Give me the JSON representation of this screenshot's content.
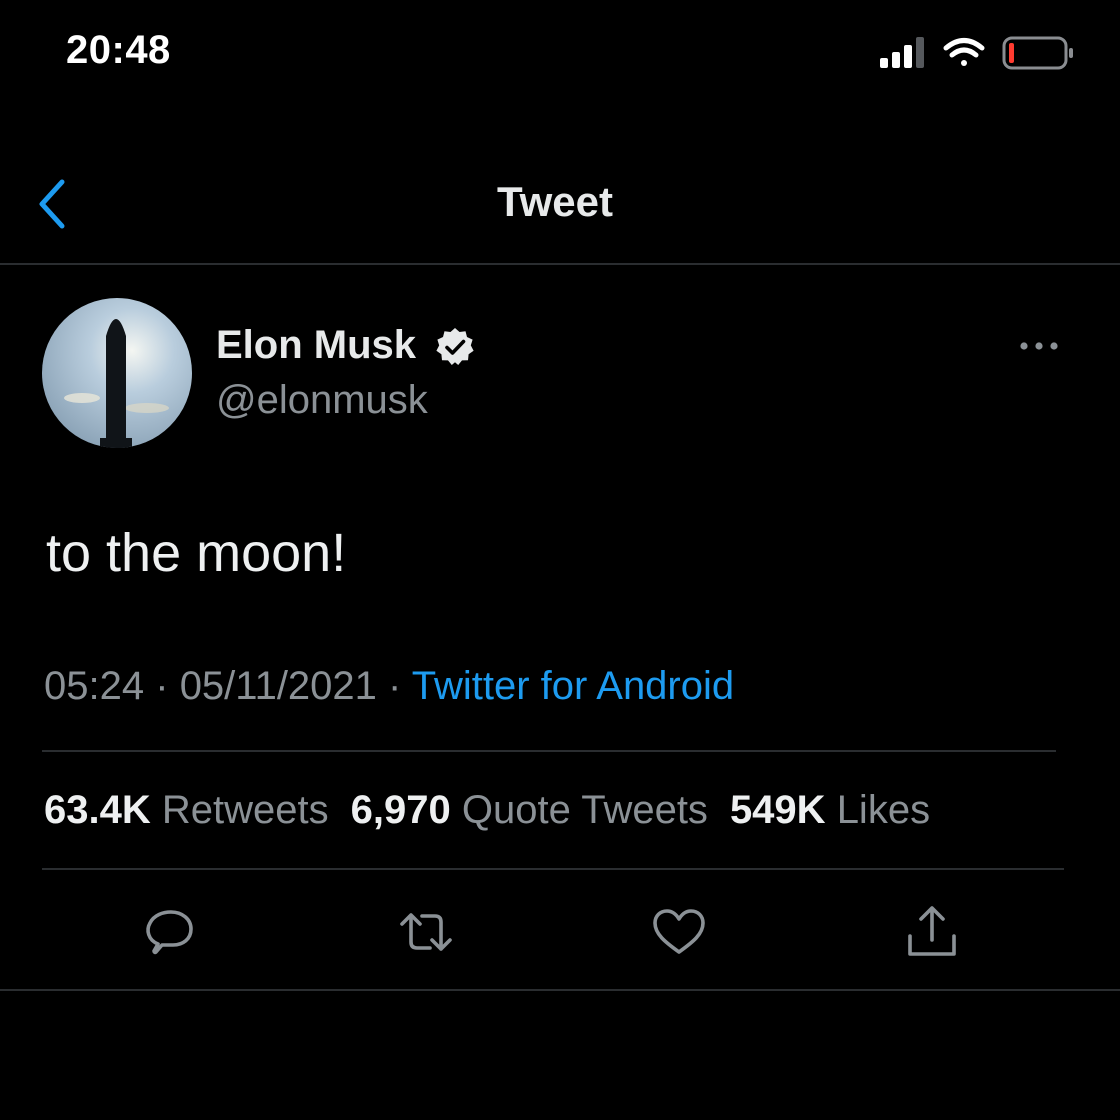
{
  "status_bar": {
    "time": "20:48",
    "icons": [
      "cellular-signal-icon",
      "wifi-icon",
      "battery-low-icon"
    ],
    "battery_color": "#ff3b30"
  },
  "header": {
    "title": "Tweet",
    "back_icon": "chevron-left-icon",
    "accent": "#1d9bf0"
  },
  "tweet": {
    "author": {
      "name": "Elon Musk",
      "handle": "@elonmusk",
      "verified": true,
      "avatar": "starship-silhouette-avatar"
    },
    "more_icon": "ellipsis-icon",
    "text": "to the moon!",
    "meta": {
      "time": "05:24",
      "separator": "·",
      "date": "05/11/2021",
      "source": "Twitter for Android"
    },
    "stats": {
      "retweets": {
        "count": "63.4K",
        "label": "Retweets"
      },
      "quote_tweets": {
        "count": "6,970",
        "label": "Quote Tweets"
      },
      "likes": {
        "count": "549K",
        "label": "Likes"
      }
    },
    "actions": [
      "reply-icon",
      "retweet-icon",
      "like-icon",
      "share-icon"
    ]
  }
}
